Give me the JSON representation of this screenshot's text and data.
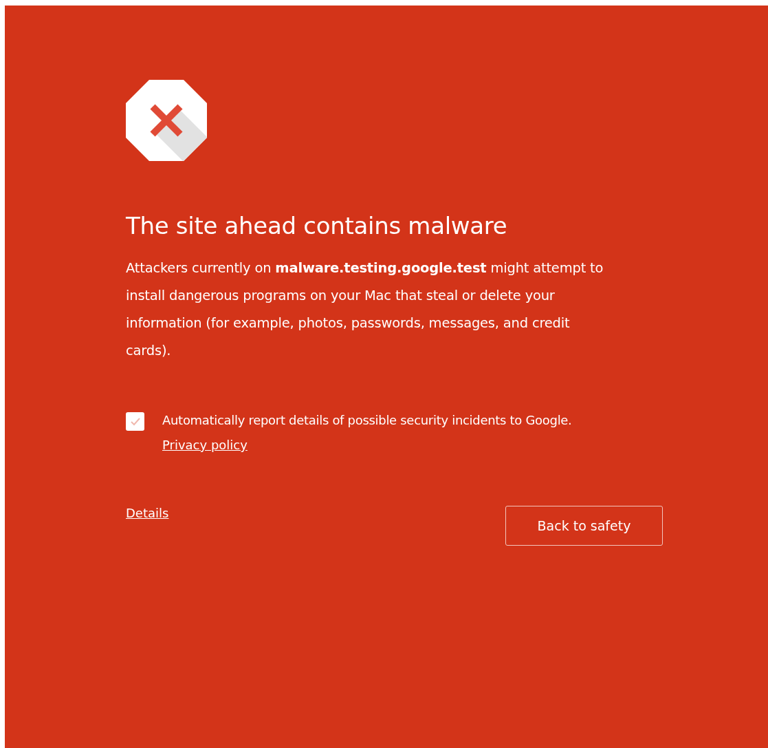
{
  "title": "The site ahead contains malware",
  "message": "Attackers currently on **malware.testing.google.test** might attempt to install dangerous programs on your Mac that steal or delete your information (for example, photos, passwords, messages, and credit cards).",
  "report": {
    "label": "Automatically report details of possible security incidents to Google.",
    "checked": true,
    "link": "Privacy policy"
  },
  "details_link": "Details",
  "back_button": "Back to safety"
}
